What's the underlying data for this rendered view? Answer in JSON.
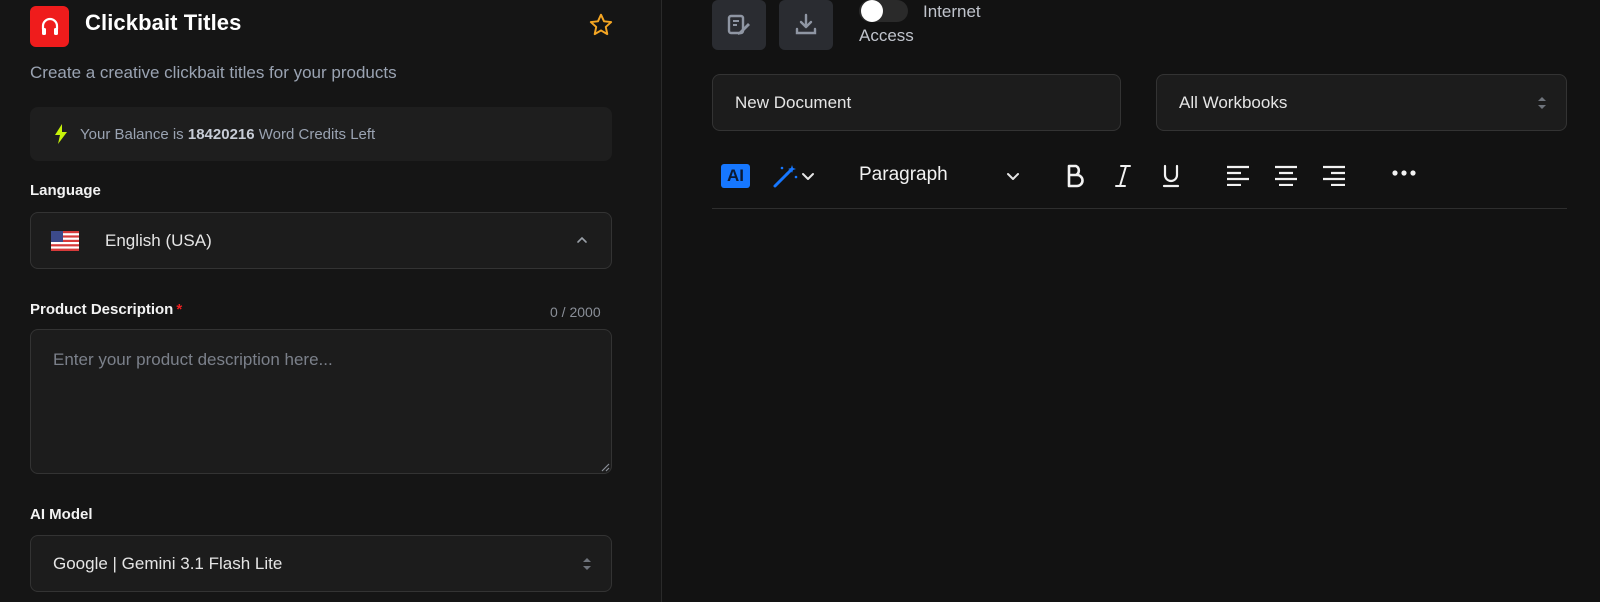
{
  "left_panel": {
    "title": "Clickbait Titles",
    "subtitle": "Create a creative clickbait titles for your products",
    "balance": {
      "prefix": "Your Balance is",
      "amount": "18420216",
      "suffix": "Word Credits Left"
    },
    "language": {
      "label": "Language",
      "value": "English (USA)"
    },
    "product_description": {
      "label": "Product Description",
      "required_mark": "*",
      "counter": "0 / 2000",
      "placeholder": "Enter your product description here..."
    },
    "ai_model": {
      "label": "AI Model",
      "value": "Google | Gemini 3.1 Flash Lite"
    }
  },
  "right_panel": {
    "internet_access": {
      "line1": "Internet",
      "line2": "Access",
      "enabled": false
    },
    "document_name": "New Document",
    "workbook_select": "All Workbooks",
    "toolbar": {
      "ai_label": "AI",
      "block_format": "Paragraph"
    }
  },
  "colors": {
    "accent_red": "#ef1c1c",
    "accent_blue": "#1677ff",
    "star": "#f5a623",
    "bolt": "#c6f20a"
  }
}
